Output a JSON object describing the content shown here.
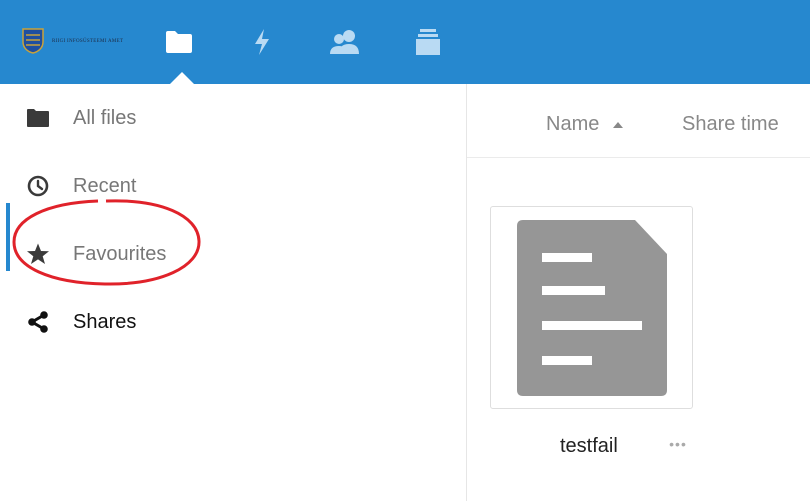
{
  "header": {
    "logo_text": "RIIGI INFOSÜSTEEMI AMET",
    "apps": [
      {
        "name": "files",
        "icon": "folder-icon",
        "active": true
      },
      {
        "name": "activity",
        "icon": "lightning-icon",
        "active": false
      },
      {
        "name": "contacts",
        "icon": "contacts-icon",
        "active": false
      },
      {
        "name": "deck",
        "icon": "stack-icon",
        "active": false
      }
    ],
    "colors": {
      "background": "#2688cf",
      "icon": "#ffffff"
    }
  },
  "sidebar": {
    "items": [
      {
        "label": "All files",
        "icon": "folder-icon",
        "active": false
      },
      {
        "label": "Recent",
        "icon": "clock-icon",
        "active": false
      },
      {
        "label": "Favourites",
        "icon": "star-icon",
        "active": false
      },
      {
        "label": "Shares",
        "icon": "share-icon",
        "active": true
      }
    ],
    "highlight_color": "#e0222a"
  },
  "main": {
    "columns": {
      "name": "Name",
      "share_time": "Share time"
    },
    "files": [
      {
        "name": "testfail",
        "menu": "•••",
        "icon": "document-icon"
      }
    ]
  }
}
